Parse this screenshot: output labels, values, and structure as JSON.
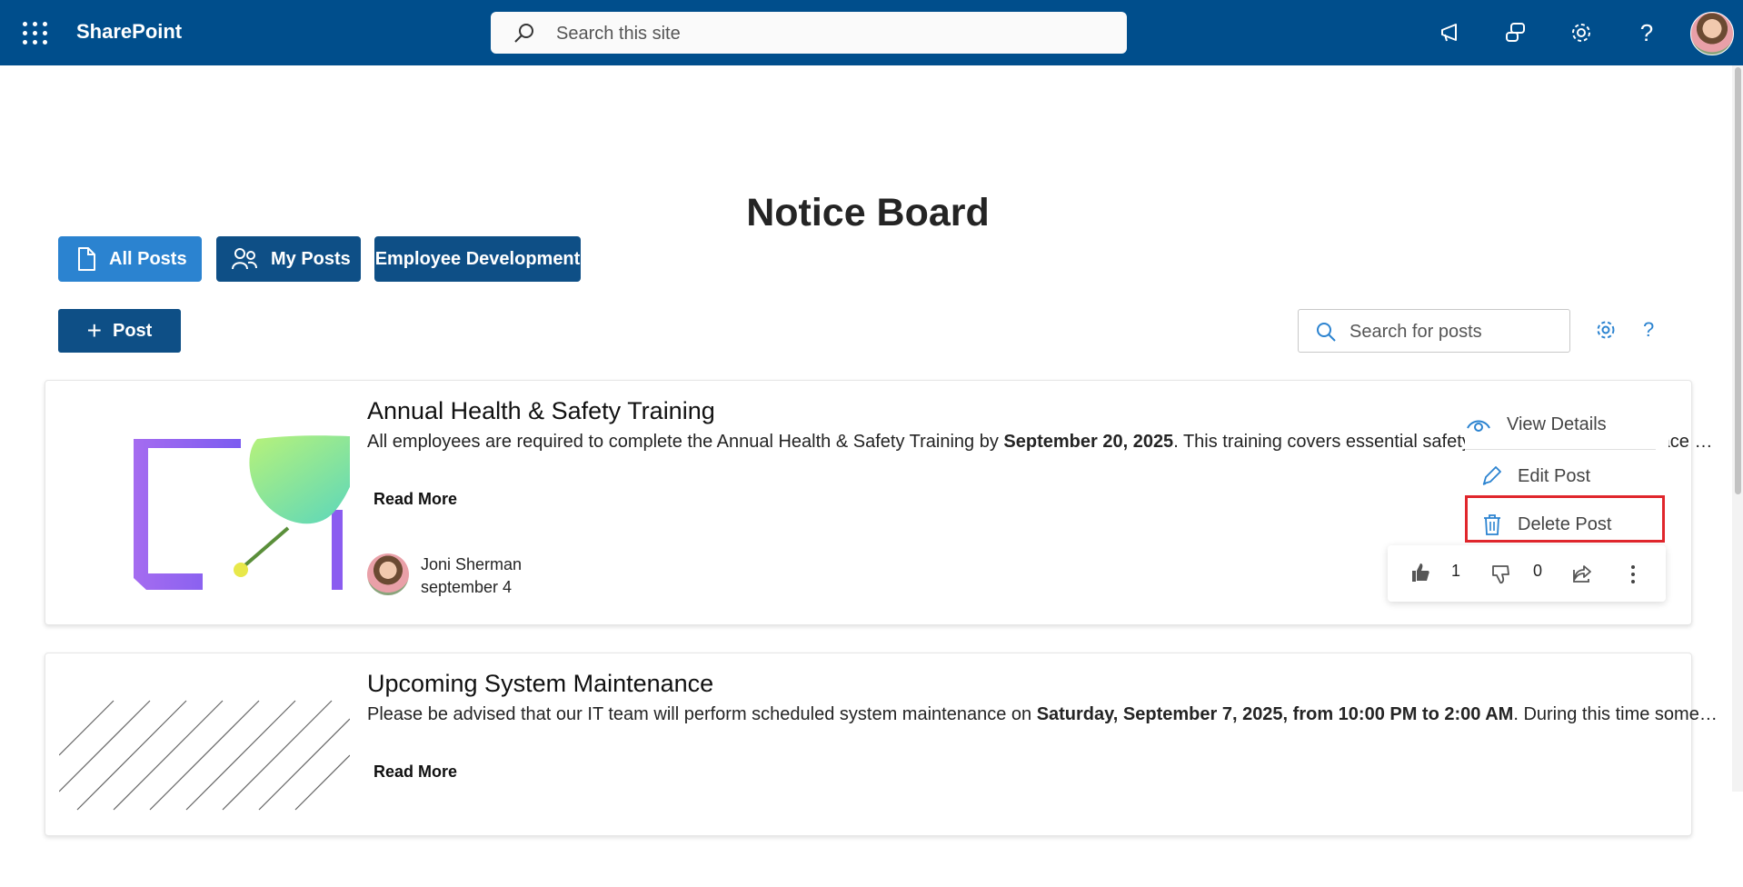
{
  "suitebar": {
    "app_name": "SharePoint",
    "search_placeholder": "Search this site",
    "icons": [
      "waffle-icon",
      "megaphone-icon",
      "switch-icon",
      "gear-icon",
      "help-icon"
    ],
    "help_glyph": "?"
  },
  "page": {
    "title": "Notice Board",
    "tabs": [
      {
        "label": "All Posts",
        "icon": "document-icon",
        "selected": true
      },
      {
        "label": "My Posts",
        "icon": "people-icon",
        "selected": false
      },
      {
        "label": "Employee Development",
        "selected": false
      }
    ],
    "new_post_label": "Post",
    "new_post_glyph": "+",
    "search_placeholder": "Search for posts",
    "help_glyph": "?"
  },
  "posts": [
    {
      "title": "Annual Health & Safety Training",
      "body_prefix": "All employees are required to complete the Annual Health & Safety Training by ",
      "body_bold": "September 20, 2025",
      "body_suffix": ". This training covers essential safety procedures and workplace health guidelines for all staff members in every department...",
      "read_more": "Read More",
      "author": "Joni Sherman",
      "date": "september 4",
      "likes": "1",
      "dislikes": "0"
    },
    {
      "title": "Upcoming System Maintenance",
      "body_prefix": "Please be advised that our IT team will perform scheduled system maintenance on ",
      "body_bold": "Saturday, September 7, 2025, from 10:00 PM to 2:00 AM",
      "body_suffix": ". During this time some services will be temporarily unavailable...",
      "read_more": "Read More"
    }
  ],
  "context_menu": {
    "items": [
      {
        "label": "View Details",
        "icon": "eye-icon"
      },
      {
        "label": "Edit Post",
        "icon": "pencil-icon"
      },
      {
        "label": "Delete Post",
        "icon": "trash-icon"
      }
    ],
    "highlight_color": "#e0262c"
  },
  "colors": {
    "suitebar": "#004e8c",
    "tab_active": "#2b83d0",
    "tab_inactive": "#0e4f86",
    "accent": "#2b83d0"
  }
}
